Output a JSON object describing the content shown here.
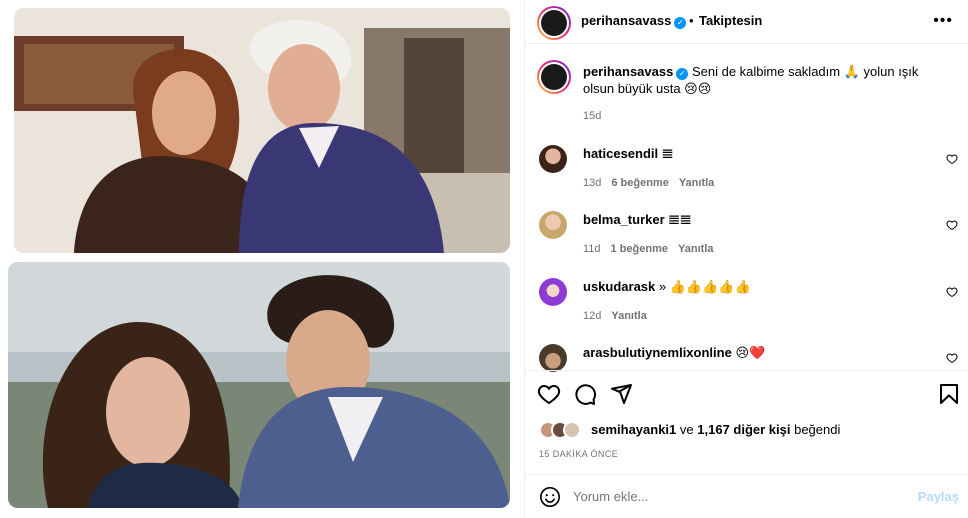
{
  "post": {
    "author": "perihansavass",
    "follow_label": "Takiptesin",
    "separator": "•",
    "more_label": "•••",
    "caption": "Seni de kalbime sakladım 🙏 yolun ışık olsun büyük usta 😢😢",
    "caption_age": "15d",
    "likers_prefix": "semihayanki1",
    "likers_mid": " ve ",
    "likers_count": "1,167 diğer kişi",
    "likers_suffix": " beğendi",
    "time_ago": "15 DAKİKA ÖNCE"
  },
  "comments": [
    {
      "user": "haticesendil",
      "text": "𝌆",
      "age": "13d",
      "likes": "6 beğenme",
      "reply": "Yanıtla"
    },
    {
      "user": "belma_turker",
      "text": "𝌆𝌆",
      "age": "11d",
      "likes": "1 beğenme",
      "reply": "Yanıtla"
    },
    {
      "user": "uskudarask",
      "text": "» 👍👍👍👍👍",
      "age": "12d",
      "likes": "",
      "reply": "Yanıtla"
    },
    {
      "user": "arasbulutiynemlixonline",
      "text": "😢❤️",
      "age": "",
      "likes": "",
      "reply": ""
    }
  ],
  "comment_box": {
    "placeholder": "Yorum ekle...",
    "share_label": "Paylaş"
  },
  "colors": {
    "accent": "#0095f6",
    "share_disabled": "#b3dbff",
    "muted": "#737373",
    "divider": "#efefef"
  },
  "icons": [
    "heart-icon",
    "comment-icon",
    "share-icon",
    "bookmark-icon",
    "emoji-icon",
    "more-icon",
    "verified-badge-icon"
  ]
}
